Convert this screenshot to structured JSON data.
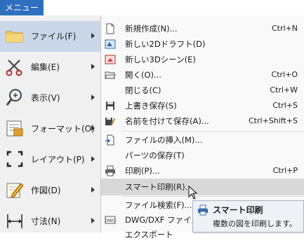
{
  "menu_tab": {
    "label": "メニュー"
  },
  "left_menu": [
    {
      "label": "ファイル(F)",
      "icon": "folder-icon",
      "active": true
    },
    {
      "label": "編集(E)",
      "icon": "scissors-icon"
    },
    {
      "label": "表示(V)",
      "icon": "magnifier-icon"
    },
    {
      "label": "フォーマット(O)",
      "icon": "format-icon"
    },
    {
      "label": "レイアウト(P)",
      "icon": "layout-frame-icon"
    },
    {
      "label": "作図(D)",
      "icon": "pencil-icon"
    },
    {
      "label": "寸法(N)",
      "icon": "dimension-icon"
    }
  ],
  "submenu": [
    {
      "label": "新規作成(N)...",
      "shortcut": "Ctrl+N",
      "icon": "new-doc-icon"
    },
    {
      "label": "新しい2Dドラフト(D)",
      "shortcut": "",
      "icon": "draft-2d-icon"
    },
    {
      "label": "新しい3Dシーン(E)",
      "shortcut": "",
      "icon": "scene-3d-icon"
    },
    {
      "label": "開く(O)...",
      "shortcut": "Ctrl+O",
      "icon": "open-folder-icon"
    },
    {
      "label": "閉じる(C)",
      "shortcut": "Ctrl+W",
      "icon": ""
    },
    {
      "label": "上書き保存(S)",
      "shortcut": "Ctrl+S",
      "icon": "save-icon"
    },
    {
      "label": "名前を付けて保存(A)...",
      "shortcut": "Ctrl+Shift+S",
      "icon": "save-as-icon"
    },
    {
      "label": "ファイルの挿入(M)...",
      "shortcut": "",
      "icon": "insert-file-icon"
    },
    {
      "label": "パーツの保存(T)",
      "shortcut": "",
      "icon": ""
    },
    {
      "label": "印刷(P)...",
      "shortcut": "Ctrl+P",
      "icon": "printer-icon"
    },
    {
      "label": "スマート印刷(R)...",
      "shortcut": "",
      "icon": ""
    },
    {
      "label": "ファイル検索(F)...",
      "shortcut": "",
      "icon": ""
    },
    {
      "label": "DWG/DXF ファイルの",
      "shortcut": "",
      "icon": "dwg-icon"
    },
    {
      "label": "エクスポート",
      "shortcut": "",
      "icon": ""
    }
  ],
  "tooltip": {
    "title": "スマート印刷",
    "description": "複数の図を印刷します。"
  },
  "colors": {
    "accent": "#2f6fc0",
    "active_item": "#c9d7e8",
    "hover_item": "#d8d8d8"
  }
}
